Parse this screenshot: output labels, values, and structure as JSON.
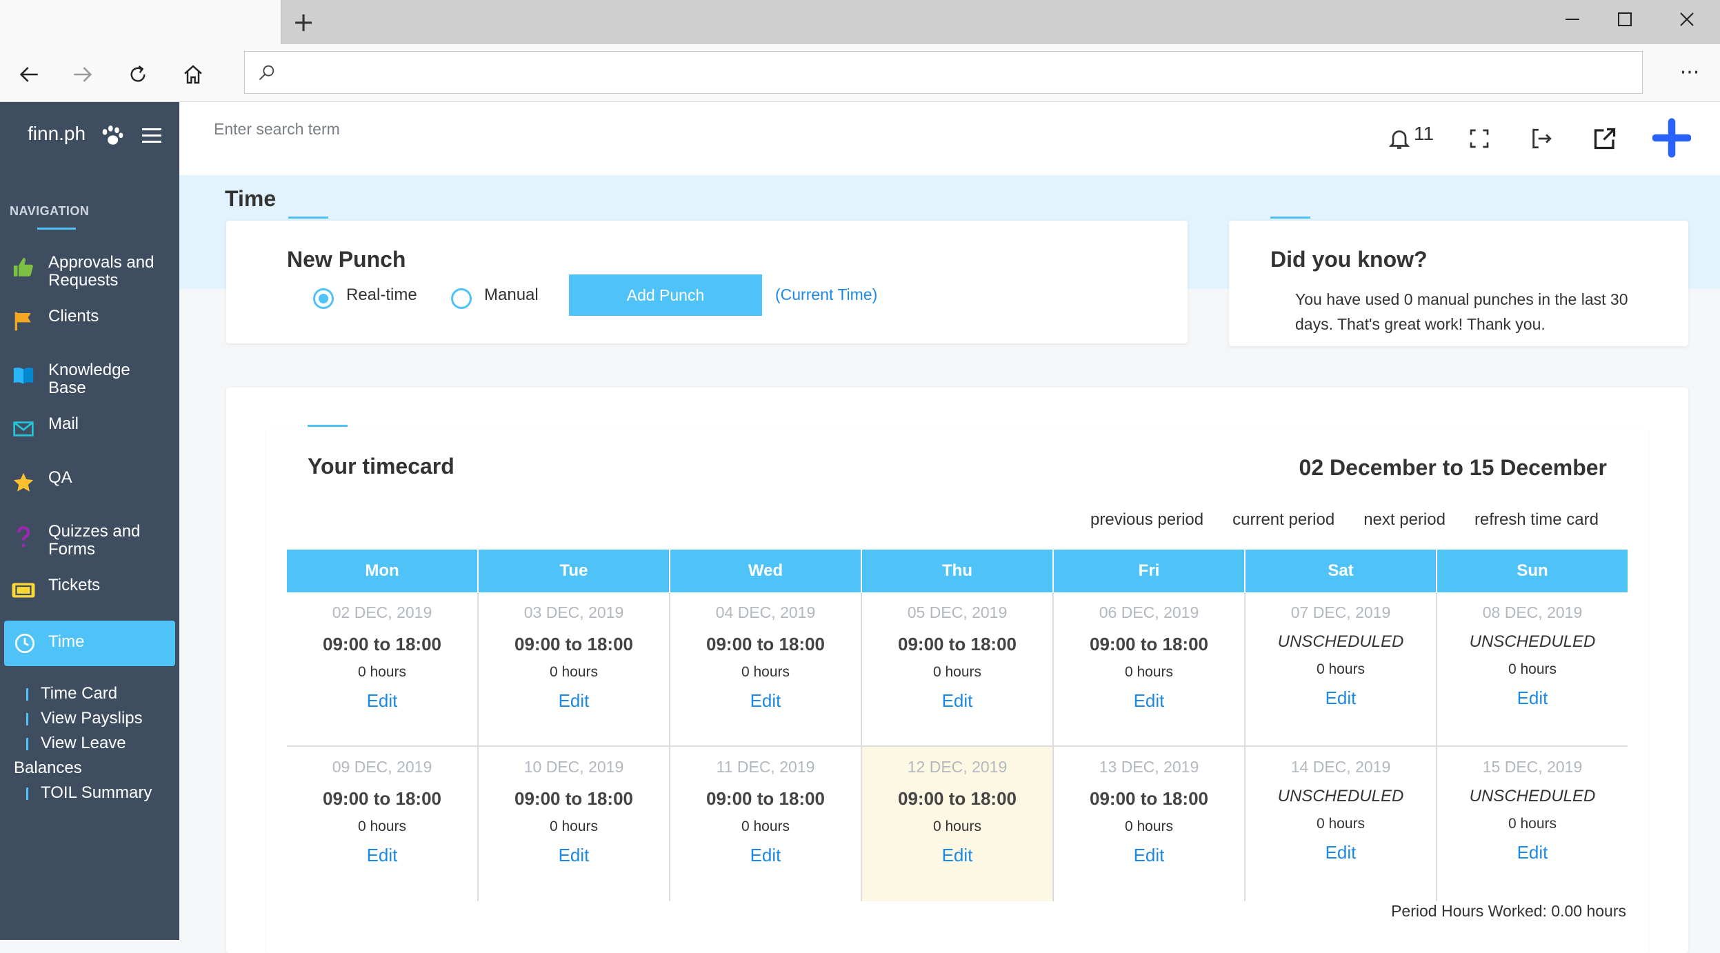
{
  "browser": {
    "new_tab_label": "+",
    "address_value": "",
    "window_controls": [
      "minimize",
      "maximize",
      "close"
    ],
    "more_label": "···"
  },
  "app": {
    "brand": "finn.ph",
    "search_placeholder": "Enter search term",
    "notification_count": "11",
    "accent_color": "#4fc3f7",
    "link_color": "#1e88e5"
  },
  "sidebar": {
    "heading": "NAVIGATION",
    "items": [
      {
        "label": "Approvals and Requests",
        "icon": "thumbs-up-icon"
      },
      {
        "label": "Clients",
        "icon": "flag-icon"
      },
      {
        "label": "Knowledge Base",
        "icon": "book-icon"
      },
      {
        "label": "Mail",
        "icon": "envelope-icon"
      },
      {
        "label": "QA",
        "icon": "star-icon"
      },
      {
        "label": "Quizzes and Forms",
        "icon": "question-icon"
      },
      {
        "label": "Tickets",
        "icon": "ticket-icon"
      },
      {
        "label": "Time",
        "icon": "clock-icon",
        "active": true
      }
    ],
    "subitems": [
      {
        "label": "Time Card"
      },
      {
        "label": "View Payslips"
      },
      {
        "label": "View Leave Balances"
      },
      {
        "label": "TOIL Summary"
      }
    ]
  },
  "page": {
    "title": "Time"
  },
  "new_punch": {
    "title": "New Punch",
    "options": [
      {
        "label": "Real-time",
        "selected": true
      },
      {
        "label": "Manual",
        "selected": false
      }
    ],
    "button": "Add Punch",
    "current_time_link": "(Current Time)"
  },
  "did_you_know": {
    "title": "Did you know?",
    "text": "You have used 0 manual punches in the last 30 days. That's great work! Thank you."
  },
  "timecard": {
    "title": "Your timecard",
    "range": "02 December to 15 December",
    "links": [
      "previous period",
      "current period",
      "next period",
      "refresh time card"
    ],
    "days": [
      "Mon",
      "Tue",
      "Wed",
      "Thu",
      "Fri",
      "Sat",
      "Sun"
    ],
    "weeks": [
      [
        {
          "date": "02 DEC, 2019",
          "shift": "09:00 to 18:00",
          "hours": "0 hours",
          "edit": "Edit"
        },
        {
          "date": "03 DEC, 2019",
          "shift": "09:00 to 18:00",
          "hours": "0 hours",
          "edit": "Edit"
        },
        {
          "date": "04 DEC, 2019",
          "shift": "09:00 to 18:00",
          "hours": "0 hours",
          "edit": "Edit"
        },
        {
          "date": "05 DEC, 2019",
          "shift": "09:00 to 18:00",
          "hours": "0 hours",
          "edit": "Edit"
        },
        {
          "date": "06 DEC, 2019",
          "shift": "09:00 to 18:00",
          "hours": "0 hours",
          "edit": "Edit"
        },
        {
          "date": "07 DEC, 2019",
          "shift": "UNSCHEDULED",
          "hours": "0 hours",
          "edit": "Edit",
          "unscheduled": true
        },
        {
          "date": "08 DEC, 2019",
          "shift": "UNSCHEDULED",
          "hours": "0 hours",
          "edit": "Edit",
          "unscheduled": true
        }
      ],
      [
        {
          "date": "09 DEC, 2019",
          "shift": "09:00 to 18:00",
          "hours": "0 hours",
          "edit": "Edit"
        },
        {
          "date": "10 DEC, 2019",
          "shift": "09:00 to 18:00",
          "hours": "0 hours",
          "edit": "Edit"
        },
        {
          "date": "11 DEC, 2019",
          "shift": "09:00 to 18:00",
          "hours": "0 hours",
          "edit": "Edit"
        },
        {
          "date": "12 DEC, 2019",
          "shift": "09:00 to 18:00",
          "hours": "0 hours",
          "edit": "Edit",
          "today": true
        },
        {
          "date": "13 DEC, 2019",
          "shift": "09:00 to 18:00",
          "hours": "0 hours",
          "edit": "Edit"
        },
        {
          "date": "14 DEC, 2019",
          "shift": "UNSCHEDULED",
          "hours": "0 hours",
          "edit": "Edit",
          "unscheduled": true
        },
        {
          "date": "15 DEC, 2019",
          "shift": "UNSCHEDULED",
          "hours": "0 hours",
          "edit": "Edit",
          "unscheduled": true
        }
      ]
    ],
    "period_hours": "Period Hours Worked: 0.00 hours"
  }
}
